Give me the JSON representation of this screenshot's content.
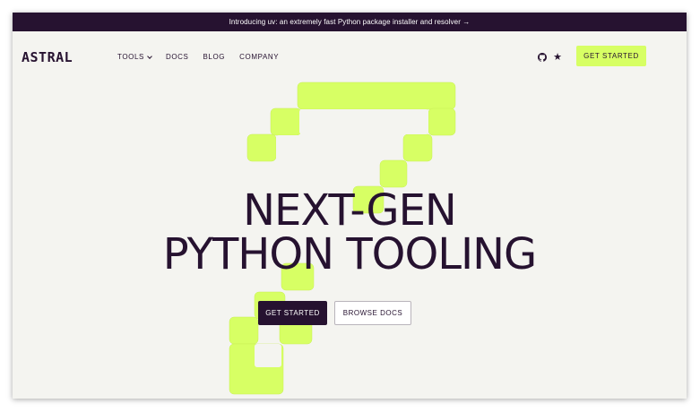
{
  "banner": {
    "text": "Introducing uv: an extremely fast Python package installer and resolver →"
  },
  "header": {
    "logo_text": "ASTRAL",
    "nav": [
      {
        "label": "TOOLS"
      },
      {
        "label": "DOCS"
      },
      {
        "label": "BLOG"
      },
      {
        "label": "COMPANY"
      }
    ],
    "github_icon": "github-icon",
    "star_icon": "star-icon",
    "star_glyph": "★",
    "cta_label": "GET STARTED"
  },
  "hero": {
    "line1": "NEXT-GEN",
    "line2": "PYTHON TOOLING",
    "primary_label": "GET STARTED",
    "secondary_label": "BROWSE DOCS"
  },
  "colors": {
    "dark": "#261230",
    "accent": "#d7ff64",
    "background": "#f4f4f0"
  }
}
